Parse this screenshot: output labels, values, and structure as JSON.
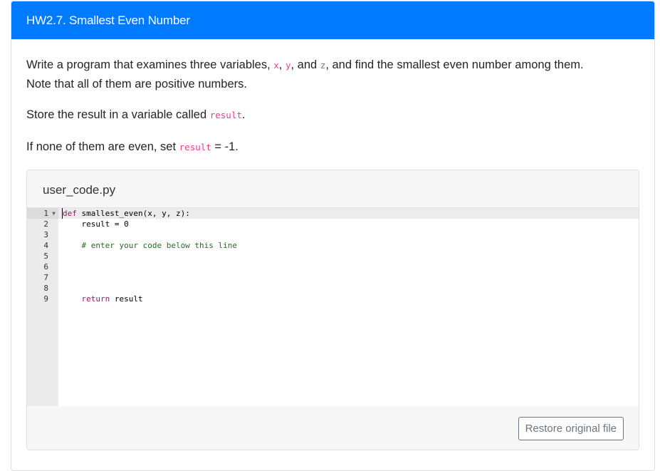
{
  "header": {
    "title": "HW2.7. Smallest Even Number"
  },
  "question": {
    "p1_a": "Write a program that examines three variables, ",
    "var_x": "x",
    "sep1": ", ",
    "var_y": "y",
    "sep2": ", and ",
    "var_z": "z",
    "p1_b": ", and find the smallest even number among them.",
    "p1_c": "Note that all of them are positive numbers.",
    "p2_a": "Store the result in a variable called ",
    "p2_code": "result",
    "p2_b": ".",
    "p3_a": "If none of them are even, set ",
    "p3_code": "result",
    "p3_b": " = -1."
  },
  "file": {
    "name": "user_code.py",
    "line_numbers": [
      "1",
      "2",
      "3",
      "4",
      "5",
      "6",
      "7",
      "8",
      "9"
    ],
    "code": {
      "l1_kw": "def",
      "l1_rest": " smallest_even(x, y, z):",
      "l2_a": "    result = ",
      "l2_num": "0",
      "l4_comment": "    # enter your code below this line",
      "l9_kw": "    return",
      "l9_rest": " result"
    },
    "restore_button": "Restore original file"
  },
  "colors": {
    "header_bg": "#007bff",
    "inline_code": "#e83e8c",
    "keyword": "#931a68",
    "comment": "#236e24"
  }
}
